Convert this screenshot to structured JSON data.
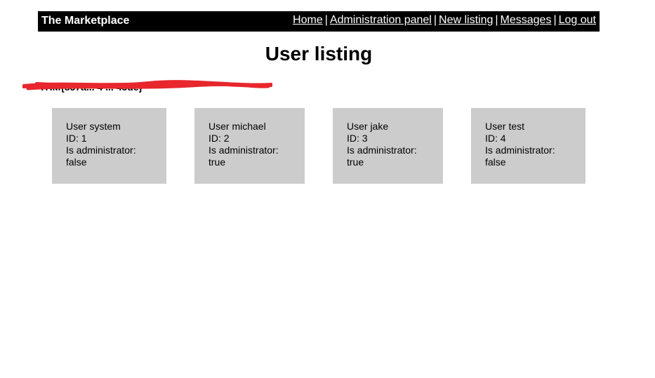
{
  "header": {
    "brand": "The Marketplace",
    "nav": [
      {
        "label": "Home"
      },
      {
        "label": "Administration panel"
      },
      {
        "label": "New listing"
      },
      {
        "label": "Messages"
      },
      {
        "label": "Log out"
      }
    ],
    "separator": "|"
  },
  "main": {
    "title": "User listing",
    "redacted_text": "THM{857a... 4 ... 45de}",
    "users": [
      {
        "name_line": "User system",
        "id_line": "ID: 1",
        "admin_label": "Is administrator:",
        "admin_value": "false"
      },
      {
        "name_line": "User michael",
        "id_line": "ID: 2",
        "admin_label": "Is administrator:",
        "admin_value": "true"
      },
      {
        "name_line": "User jake",
        "id_line": "ID: 3",
        "admin_label": "Is administrator:",
        "admin_value": "true"
      },
      {
        "name_line": "User test",
        "id_line": "ID: 4",
        "admin_label": "Is administrator:",
        "admin_value": "false"
      }
    ]
  },
  "colors": {
    "navbar_bg": "#000000",
    "card_bg": "#cccccc",
    "redaction": "#e8262d"
  }
}
